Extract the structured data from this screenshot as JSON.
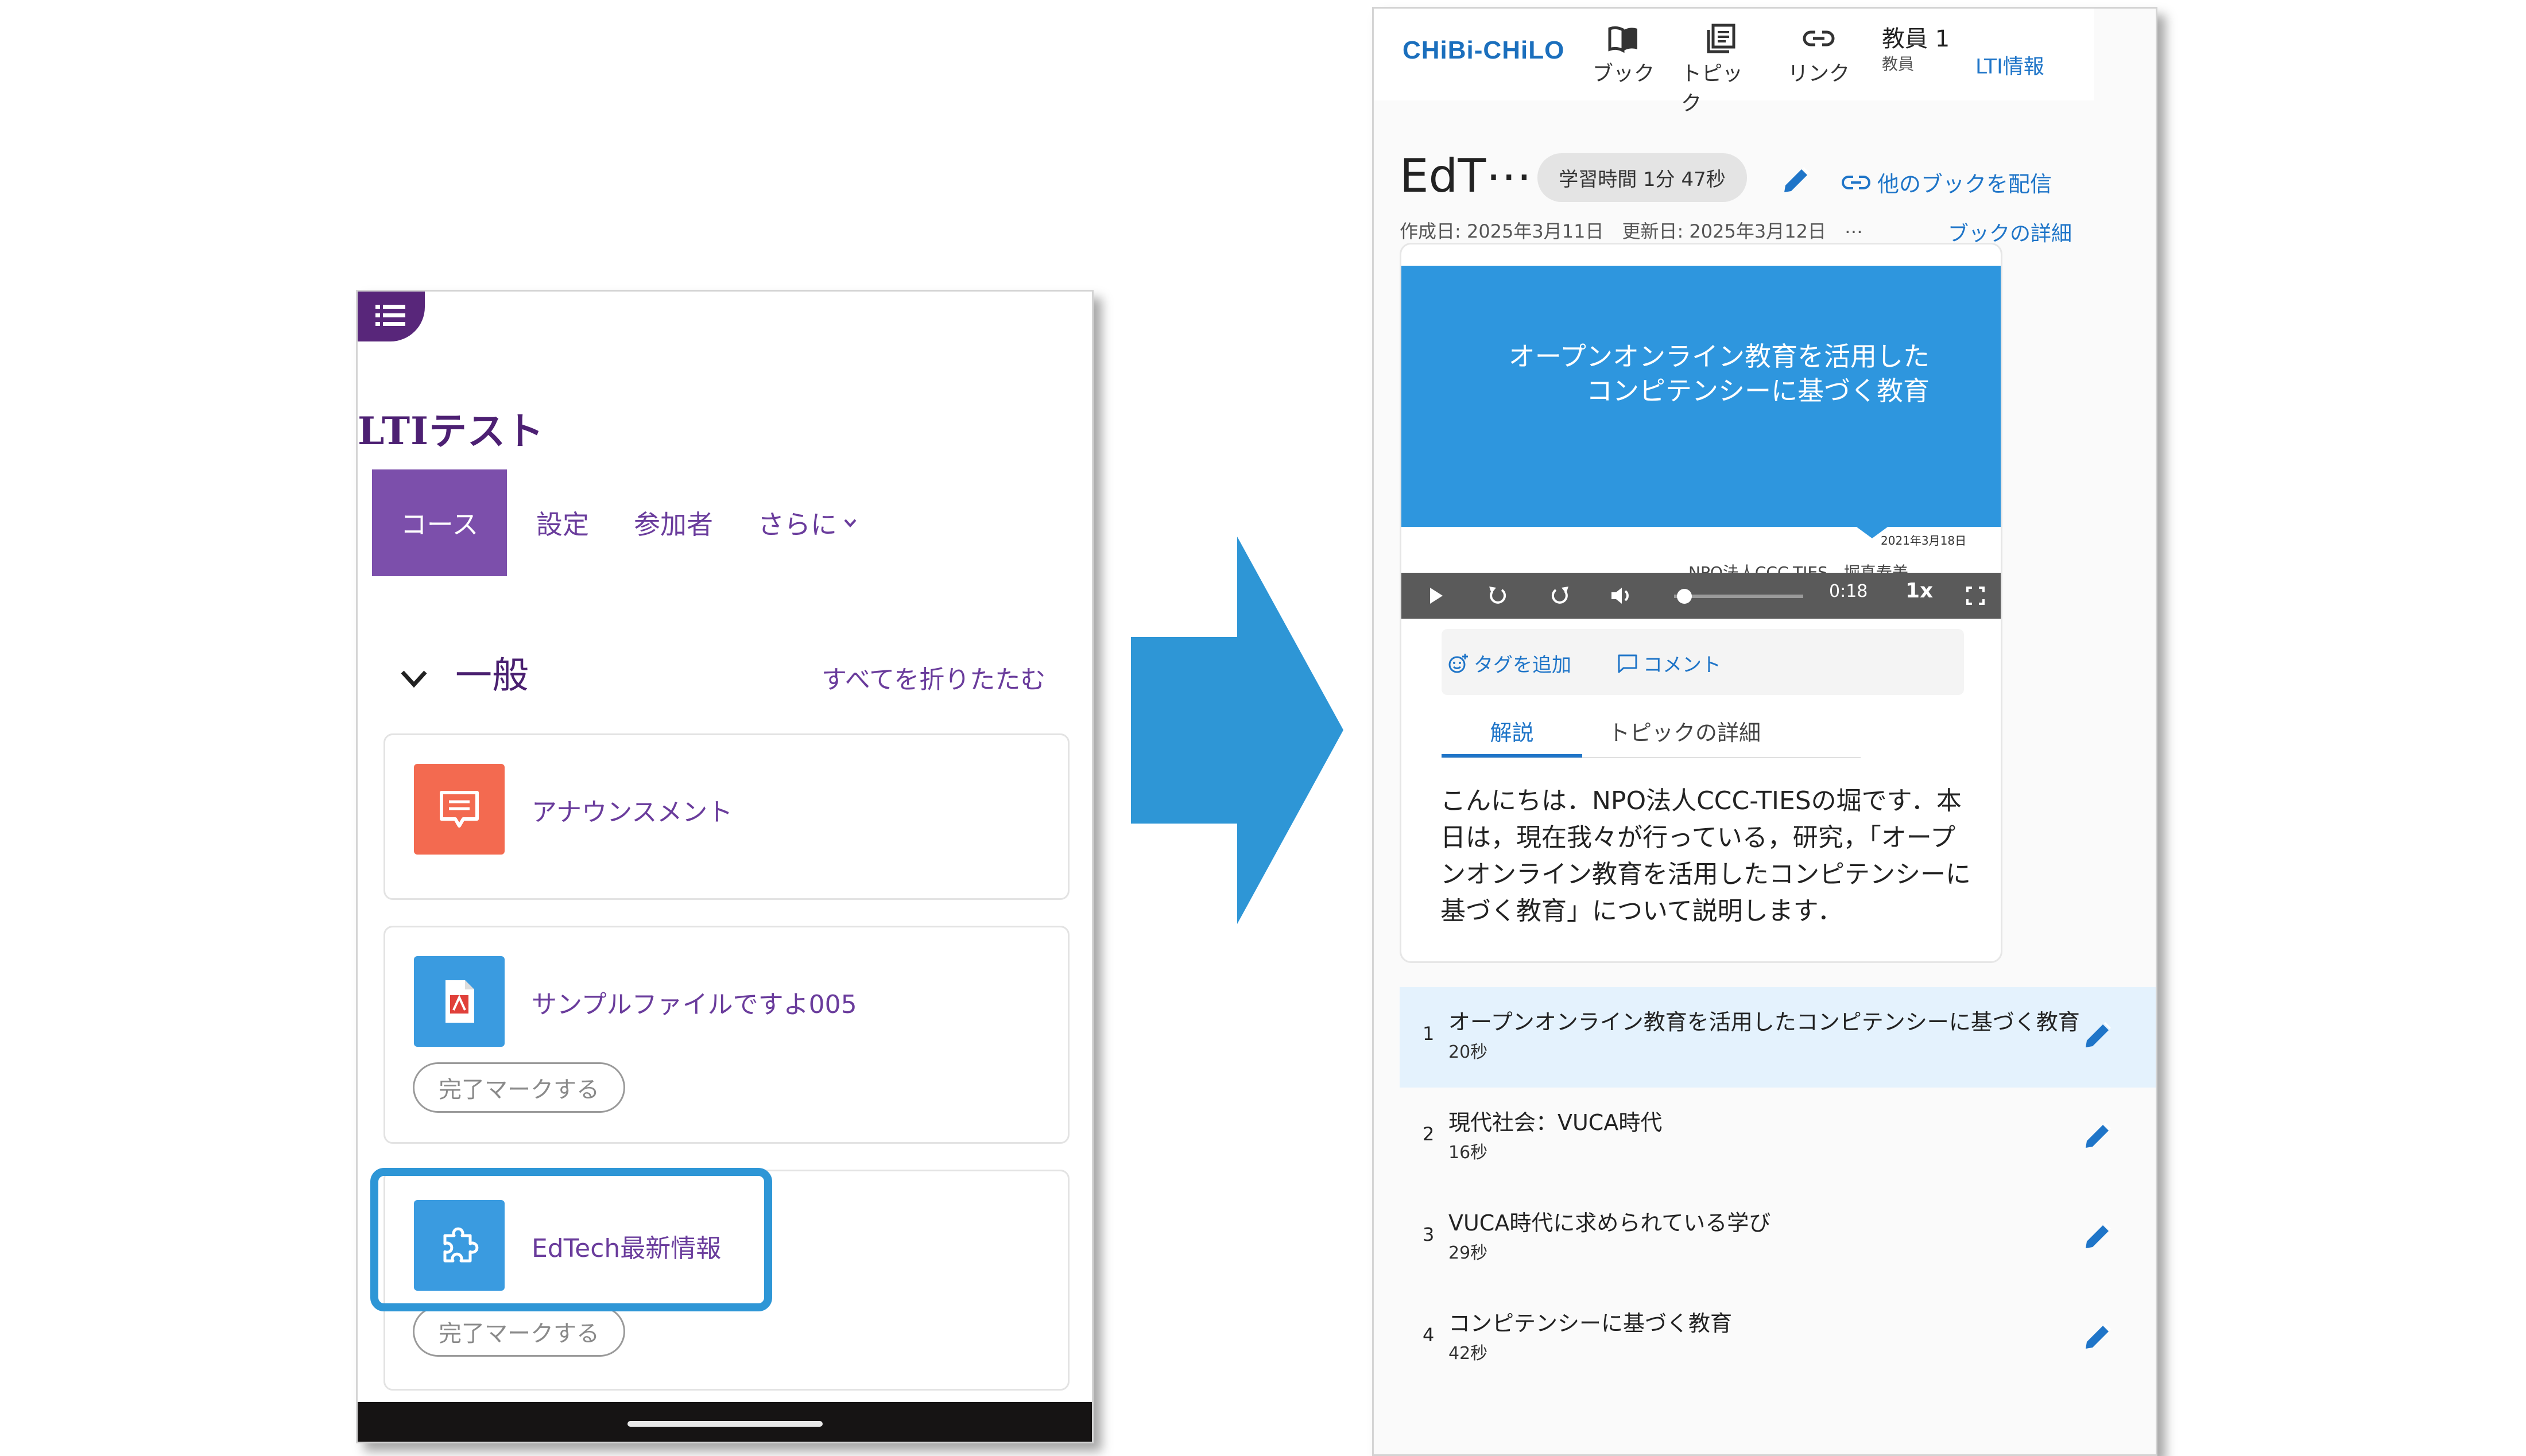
{
  "moodle": {
    "course_title": "LTIテスト",
    "tabs": [
      {
        "label": "コース"
      },
      {
        "label": "設定"
      },
      {
        "label": "参加者"
      },
      {
        "label": "さらに"
      }
    ],
    "section": {
      "title": "一般",
      "collapse_all": "すべてを折りたたむ"
    },
    "activities": [
      {
        "label": "アナウンスメント",
        "icon": "forum-icon",
        "color": "#f36a50"
      },
      {
        "label": "サンプルファイルですよ005",
        "icon": "pdf-file-icon",
        "color": "#3a9be0",
        "done_button": "完了マークする"
      },
      {
        "label": "EdTech最新情報",
        "icon": "puzzle-icon",
        "color": "#3a9be0",
        "done_button": "完了マークする"
      }
    ],
    "highlight_color": "#2e96d6"
  },
  "chibichilo": {
    "logo": "CHiBi-CHiLO",
    "nav": [
      {
        "label": "ブック",
        "icon": "book-icon"
      },
      {
        "label": "トピック",
        "icon": "topic-icon"
      },
      {
        "label": "リンク",
        "icon": "link-icon"
      }
    ],
    "user": {
      "name": "教員 1",
      "role": "教員"
    },
    "lti_info": "LTI情報",
    "book": {
      "title": "EdT⋯",
      "study_time": "学習時間 1分 47秒",
      "share": "他のブックを配信",
      "dates": "作成日: 2025年3月11日　更新日: 2025年3月12日　⋯",
      "detail_link": "ブックの詳細"
    },
    "video": {
      "slide_title_line1": "オープンオンライン教育を活用した",
      "slide_title_line2": "コンピテンシーに基づく教育",
      "slide_date": "2021年3月18日",
      "slide_caption": "NPO法人CCC-TIES　堀真寿美",
      "time": "0:18",
      "speed": "1x",
      "progress": 0.08
    },
    "actions": {
      "add_tag": "タグを追加",
      "comment": "コメント"
    },
    "tabs": {
      "description": "解説",
      "topic_detail": "トピックの詳細"
    },
    "description": "こんにちは．NPO法人CCC-TIESの堀です．本日は，現在我々が行っている，研究，「オープンオンライン教育を活用したコンピテンシーに基づく教育」について説明します．",
    "topics": [
      {
        "num": "1",
        "title": "オープンオンライン教育を活用したコンピテンシーに基づく教育",
        "duration": "20秒"
      },
      {
        "num": "2",
        "title": "現代社会：VUCA時代",
        "duration": "16秒"
      },
      {
        "num": "3",
        "title": "VUCA時代に求められている学び",
        "duration": "29秒"
      },
      {
        "num": "4",
        "title": "コンピテンシーに基づく教育",
        "duration": "42秒"
      }
    ],
    "accent": "#1f75c8"
  }
}
